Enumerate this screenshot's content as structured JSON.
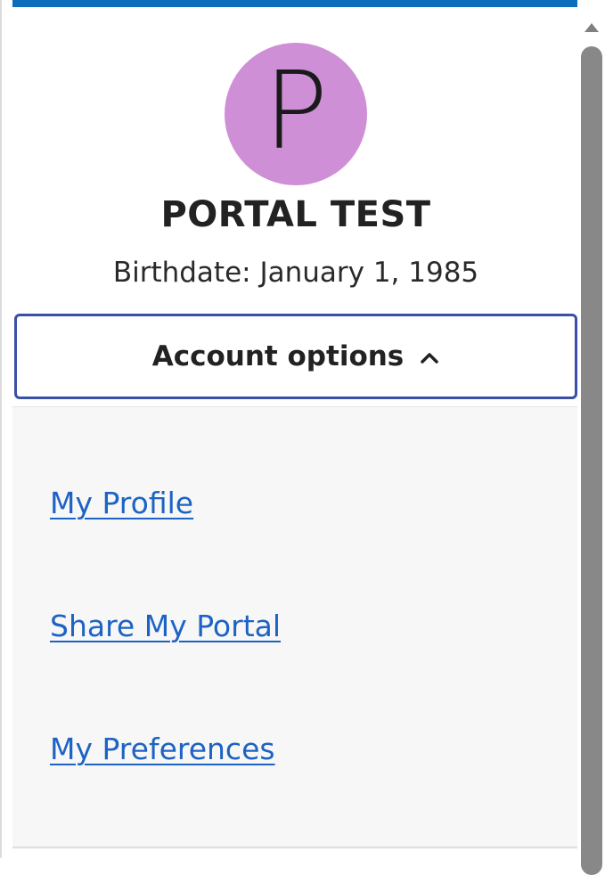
{
  "profile": {
    "avatar_letter": "P",
    "avatar_color": "#ce8fd6",
    "name": "PORTAL TEST",
    "birthdate": "Birthdate: January 1, 1985"
  },
  "account_options": {
    "label": "Account options",
    "expanded": true,
    "icon": "chevron-up-icon"
  },
  "menu": {
    "items": [
      {
        "label": "My Profile"
      },
      {
        "label": "Share My Portal"
      },
      {
        "label": "My Preferences"
      }
    ]
  },
  "colors": {
    "accent": "#0a6ebd",
    "button_border": "#3a4fa6",
    "link": "#1d63c4"
  }
}
